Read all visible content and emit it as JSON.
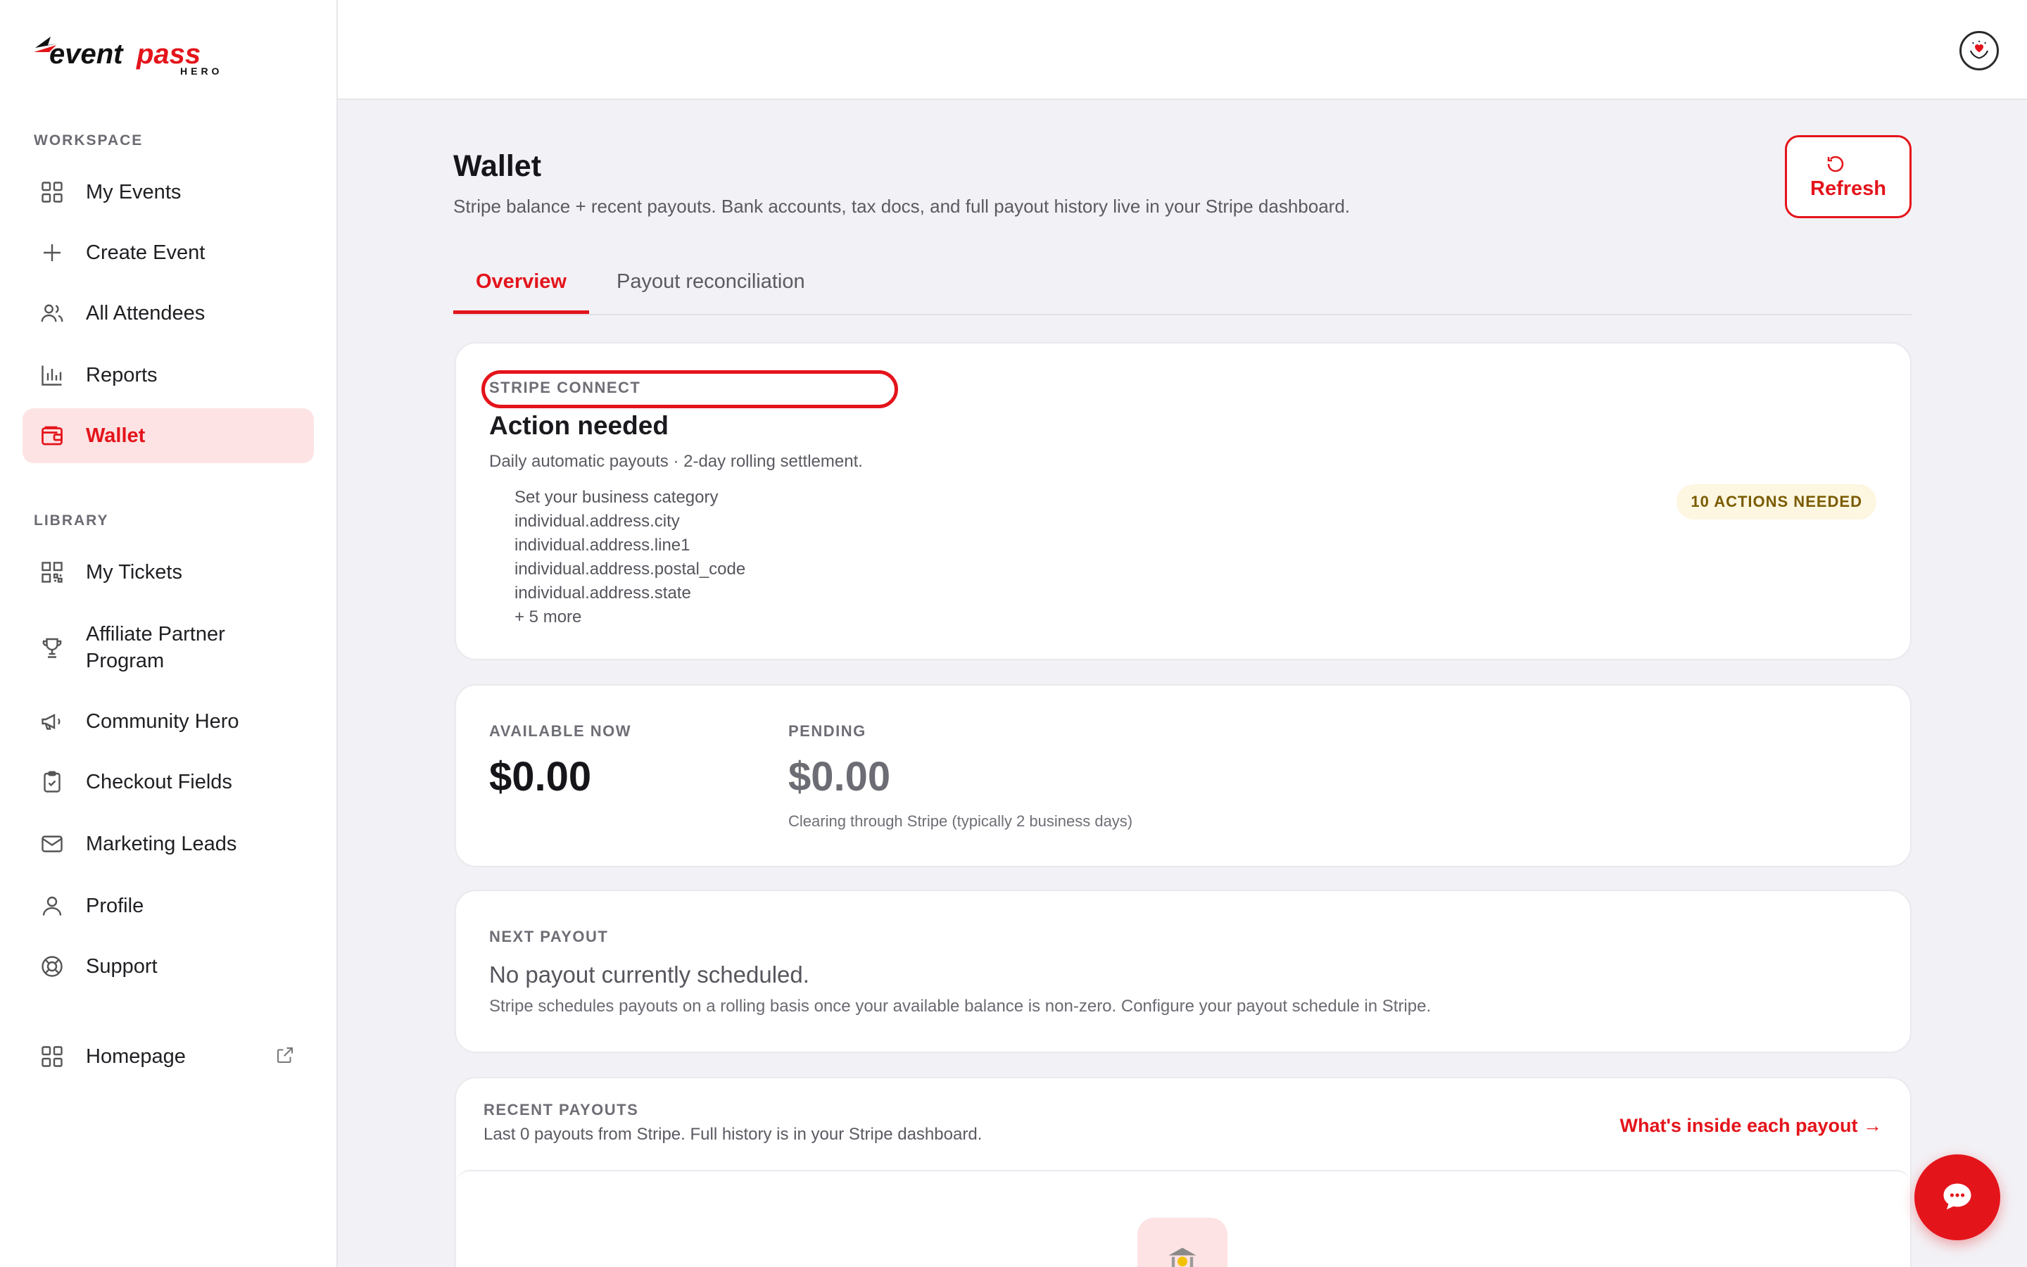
{
  "brand": {
    "logo_text": "eventpass",
    "logo_sub": "HERO",
    "accent_color": "#e4141b",
    "icon": "eventpass-hero-logo"
  },
  "sidebar": {
    "workspace_label": "WORKSPACE",
    "library_label": "LIBRARY",
    "workspace_items": [
      {
        "label": "My Events",
        "icon": "grid-icon"
      },
      {
        "label": "Create Event",
        "icon": "plus-icon"
      },
      {
        "label": "All Attendees",
        "icon": "users-icon"
      },
      {
        "label": "Reports",
        "icon": "bar-chart-icon"
      },
      {
        "label": "Wallet",
        "icon": "wallet-icon",
        "active": true
      }
    ],
    "library_items": [
      {
        "label": "My Tickets",
        "icon": "qr-code-icon"
      },
      {
        "label": "Affiliate Partner Program",
        "icon": "trophy-icon"
      },
      {
        "label": "Community Hero",
        "icon": "megaphone-icon"
      },
      {
        "label": "Checkout Fields",
        "icon": "clipboard-icon"
      },
      {
        "label": "Marketing Leads",
        "icon": "mail-icon"
      },
      {
        "label": "Profile",
        "icon": "user-icon"
      },
      {
        "label": "Support",
        "icon": "lifebuoy-icon"
      }
    ],
    "homepage": {
      "label": "Homepage",
      "icon": "grid-icon",
      "external_icon": "external-link-icon"
    }
  },
  "header": {
    "title": "Wallet",
    "subtitle": "Stripe balance + recent payouts. Bank accounts, tax docs, and full payout history live in your Stripe dashboard.",
    "refresh_label": "Refresh"
  },
  "tabs": [
    {
      "label": "Overview",
      "active": true
    },
    {
      "label": "Payout reconciliation",
      "active": false
    }
  ],
  "stripe_connect": {
    "overline": "STRIPE CONNECT",
    "title": "Action needed",
    "subtitle": "Daily automatic payouts · 2-day rolling settlement.",
    "actions": [
      "Set your business category",
      "individual.address.city",
      "individual.address.line1",
      "individual.address.postal_code",
      "individual.address.state",
      "+ 5 more"
    ],
    "badge": "10 ACTIONS NEEDED"
  },
  "balance": {
    "available_label": "AVAILABLE NOW",
    "available_amount": "$0.00",
    "pending_label": "PENDING",
    "pending_amount": "$0.00",
    "pending_note": "Clearing through Stripe (typically 2 business days)"
  },
  "next_payout": {
    "overline": "NEXT PAYOUT",
    "title": "No payout currently scheduled.",
    "subtitle": "Stripe schedules payouts on a rolling basis once your available balance is non-zero. Configure your payout schedule in Stripe."
  },
  "recent_payouts": {
    "overline": "RECENT PAYOUTS",
    "subtitle": "Last 0 payouts from Stripe. Full history is in your Stripe dashboard.",
    "link": "What's inside each payout →",
    "empty_icon": "bank-icon"
  }
}
